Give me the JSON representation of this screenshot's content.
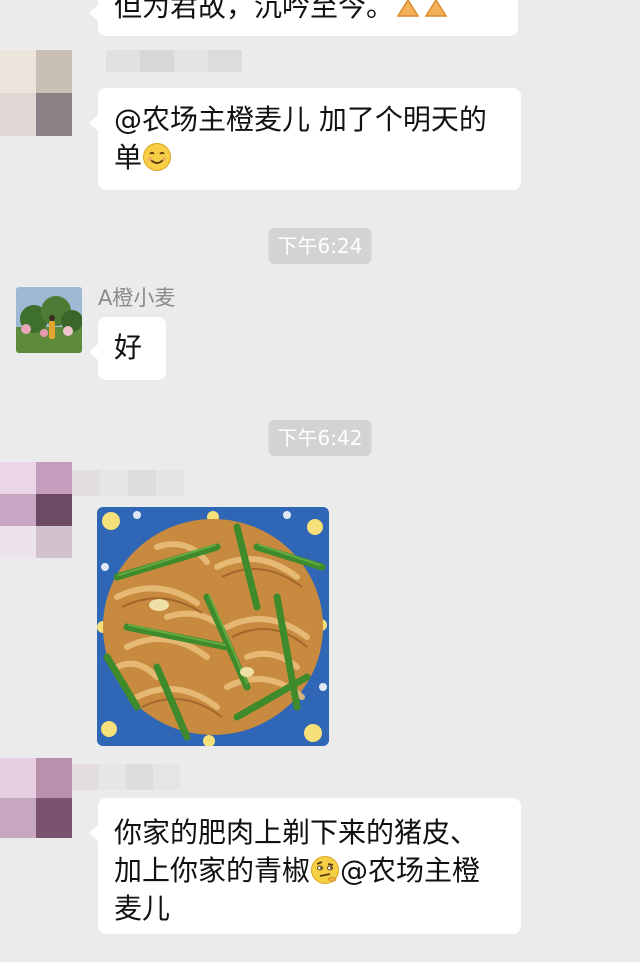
{
  "chat": {
    "top_partial": "但为君故，沉吟至今。",
    "msg1_line1": "@农场主橙麦儿 加了个明天的",
    "msg1_line2": "单",
    "time1": "下午6:24",
    "sender_name": "A橙小麦",
    "msg2": "好",
    "time2": "下午6:42",
    "msg3_line1": "你家的肥肉上剃下来的猪皮、",
    "msg3_line2_a": "加上你家的青椒",
    "msg3_line2_b": "@农场主橙",
    "msg3_line3": "麦儿"
  },
  "icons": {
    "pray": "folded-hands-icon",
    "smile": "smiling-face-icon",
    "doubt": "raised-eyebrow-face-icon"
  },
  "colors": {
    "background": "#ebebeb",
    "bubble": "#ffffff",
    "timestamp_bg": "#d3d3d3"
  }
}
